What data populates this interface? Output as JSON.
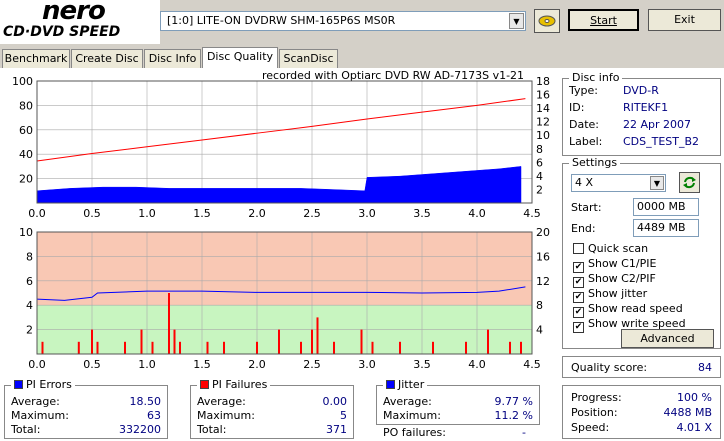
{
  "app": {
    "logo_main": "nero",
    "logo_sub": "CD·DVD SPEED",
    "drive": "[1:0]  LITE-ON DVDRW SHM-165P6S MS0R",
    "start_label": "Start",
    "exit_label": "Exit"
  },
  "tabs": [
    {
      "label": "Benchmark"
    },
    {
      "label": "Create Disc"
    },
    {
      "label": "Disc Info"
    },
    {
      "label": "Disc Quality",
      "active": true
    },
    {
      "label": "ScanDisc"
    }
  ],
  "disc_info": {
    "title": "Disc info",
    "rows": [
      {
        "label": "Type:",
        "value": "DVD-R"
      },
      {
        "label": "ID:",
        "value": "RITEKF1"
      },
      {
        "label": "Date:",
        "value": "22 Apr 2007"
      },
      {
        "label": "Label:",
        "value": "CDS_TEST_B2"
      }
    ]
  },
  "settings": {
    "title": "Settings",
    "speed": "4 X",
    "start_label": "Start:",
    "start_value": "0000 MB",
    "end_label": "End:",
    "end_value": "4489 MB",
    "options": [
      {
        "label": "Quick scan",
        "checked": false
      },
      {
        "label": "Show C1/PIE",
        "checked": true
      },
      {
        "label": "Show C2/PIF",
        "checked": true
      },
      {
        "label": "Show jitter",
        "checked": true
      },
      {
        "label": "Show read speed",
        "checked": true
      },
      {
        "label": "Show write speed",
        "checked": true
      }
    ],
    "advanced_label": "Advanced"
  },
  "quality": {
    "label": "Quality score:",
    "value": "84"
  },
  "progress": {
    "rows": [
      {
        "label": "Progress:",
        "value": "100 %"
      },
      {
        "label": "Position:",
        "value": "4488 MB"
      },
      {
        "label": "Speed:",
        "value": "4.01 X"
      }
    ]
  },
  "pi_errors": {
    "title": "PI Errors",
    "color": "#0000ff",
    "rows": [
      {
        "label": "Average:",
        "value": "18.50"
      },
      {
        "label": "Maximum:",
        "value": "63"
      },
      {
        "label": "Total:",
        "value": "332200"
      }
    ]
  },
  "pi_failures": {
    "title": "PI Failures",
    "color": "#ff0000",
    "rows": [
      {
        "label": "Average:",
        "value": "0.00"
      },
      {
        "label": "Maximum:",
        "value": "5"
      },
      {
        "label": "Total:",
        "value": "371"
      }
    ]
  },
  "jitter": {
    "title": "Jitter",
    "color": "#0000ff",
    "rows": [
      {
        "label": "Average:",
        "value": "9.77 %"
      },
      {
        "label": "Maximum:",
        "value": "11.2 %"
      }
    ],
    "po_label": "PO failures:",
    "po_value": "-"
  },
  "chart_data": [
    {
      "type": "area",
      "title": "recorded with Optiarc  DVD  RW  AD-7173S   v1-21",
      "x_ticks": [
        "0.0",
        "0.5",
        "1.0",
        "1.5",
        "2.0",
        "2.5",
        "3.0",
        "3.5",
        "4.0",
        "4.5"
      ],
      "y_left_ticks": [
        "100",
        "80",
        "60",
        "40",
        "20"
      ],
      "y_right_ticks": [
        "18",
        "16",
        "14",
        "12",
        "10",
        "8",
        "6",
        "4",
        "2"
      ],
      "xlim": [
        0,
        4.5
      ],
      "ylim_left": [
        0,
        100
      ],
      "ylim_right": [
        0,
        18
      ],
      "series": [
        {
          "name": "PI Errors",
          "color": "#0000ff",
          "x": [
            0.0,
            0.3,
            0.6,
            0.9,
            1.2,
            1.5,
            1.8,
            2.1,
            2.4,
            2.7,
            2.98,
            3.0,
            3.3,
            3.6,
            3.9,
            4.2,
            4.4
          ],
          "y": [
            10,
            12,
            13,
            13,
            12,
            12,
            12,
            12,
            12,
            11,
            10,
            21,
            22,
            24,
            26,
            28,
            30
          ]
        },
        {
          "name": "read speed",
          "color": "#ff0000",
          "x": [
            0.0,
            0.5,
            1.0,
            1.5,
            2.0,
            2.5,
            3.0,
            3.5,
            4.0,
            4.44
          ],
          "y": [
            6.2,
            7.3,
            8.3,
            9.3,
            10.3,
            11.3,
            12.4,
            13.4,
            14.4,
            15.4
          ]
        }
      ]
    },
    {
      "type": "bar",
      "x_ticks": [
        "0.0",
        "0.5",
        "1.0",
        "1.5",
        "2.0",
        "2.5",
        "3.0",
        "3.5",
        "4.0",
        "4.5"
      ],
      "y_left_ticks": [
        "10",
        "8",
        "6",
        "4",
        "2"
      ],
      "y_right_ticks": [
        "20",
        "16",
        "12",
        "8",
        "4"
      ],
      "xlim": [
        0,
        4.5
      ],
      "ylim_left": [
        0,
        10
      ],
      "ylim_right": [
        0,
        20
      ],
      "series": [
        {
          "name": "PI Failures",
          "color": "#ff0000",
          "x": [
            0.05,
            0.38,
            0.5,
            0.55,
            0.8,
            0.95,
            1.05,
            1.2,
            1.25,
            1.3,
            1.55,
            1.7,
            2.0,
            2.2,
            2.4,
            2.5,
            2.55,
            2.7,
            2.95,
            3.05,
            3.3,
            3.6,
            3.9,
            4.1,
            4.3,
            4.4
          ],
          "y": [
            1,
            1,
            2,
            1,
            1,
            2,
            1,
            5,
            2,
            1,
            1,
            1,
            1,
            2,
            1,
            2,
            3,
            1,
            2,
            1,
            1,
            1,
            1,
            2,
            1,
            1
          ]
        },
        {
          "name": "Jitter",
          "color": "#0000ff",
          "x": [
            0.0,
            0.25,
            0.5,
            0.55,
            1.0,
            1.5,
            2.0,
            2.5,
            3.0,
            3.5,
            4.0,
            4.2,
            4.44
          ],
          "y": [
            9.0,
            8.8,
            9.3,
            10.0,
            10.3,
            10.3,
            10.1,
            10.1,
            10.1,
            10.0,
            10.1,
            10.3,
            11.0
          ]
        }
      ]
    }
  ]
}
